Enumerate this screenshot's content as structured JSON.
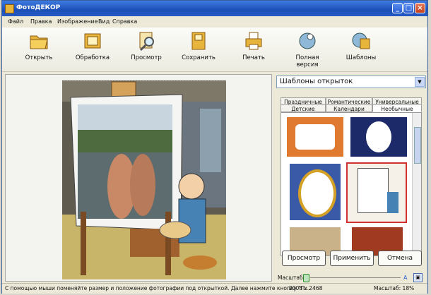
{
  "window": {
    "title": "ФотоДЕКОР",
    "controls": [
      "_",
      "□",
      "×"
    ]
  },
  "menu": [
    "Файл",
    "Правка",
    "Изображение",
    "Вид",
    "Справка"
  ],
  "toolbar": [
    {
      "label": "Открыть",
      "icon": "open-folder-icon"
    },
    {
      "label": "Обработка",
      "icon": "processing-icon"
    },
    {
      "label": "Просмотр",
      "icon": "preview-magnifier-icon"
    },
    {
      "label": "Сохранить",
      "icon": "save-icon"
    },
    {
      "label": "Печать",
      "icon": "print-icon"
    },
    {
      "label": "Полная версия",
      "icon": "full-version-icon"
    },
    {
      "label": "Шаблоны",
      "icon": "templates-icon"
    }
  ],
  "panel": {
    "dropdown": "Шаблоны открыток",
    "tabs_row1": [
      "Праздничные",
      "Романтические",
      "Универсальные"
    ],
    "tabs_row2": [
      "Детские",
      "Календари",
      "Необычные"
    ],
    "active_tab": "Необычные",
    "buttons": {
      "preview": "Просмотр",
      "apply": "Применить",
      "cancel": "Отмена"
    },
    "zoom_label": "Масштаб"
  },
  "status": {
    "hint": "С помощью мыши поменяйте размер и положение фотографии под открыткой. Далее нажмите кнопку \"П...",
    "size": "2008 x 2468",
    "zoom": "Масштаб: 18%"
  },
  "colors": {
    "title_bar": "#2459c4",
    "selection": "#d03030"
  }
}
